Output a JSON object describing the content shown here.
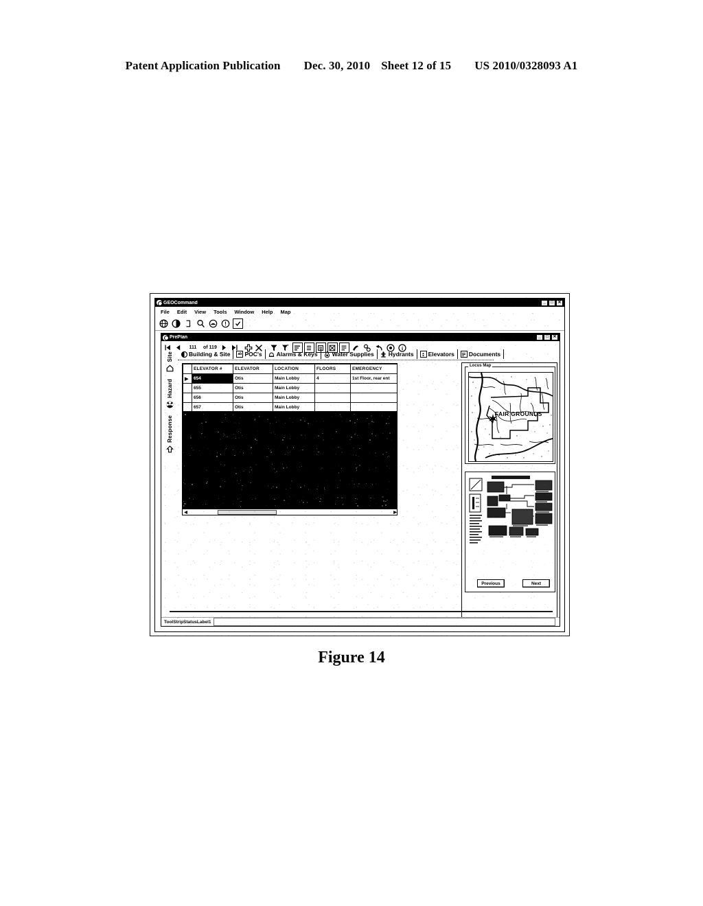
{
  "patent_header": {
    "publication": "Patent Application Publication",
    "date": "Dec. 30, 2010",
    "sheet": "Sheet 12 of 15",
    "number": "US 2010/0328093 A1"
  },
  "figure": {
    "caption": "Figure 14"
  },
  "app_window": {
    "title": "GEOCommand",
    "icon": "globe-icon",
    "window_buttons": [
      "_",
      "□",
      "✕"
    ],
    "menu": [
      "File",
      "Edit",
      "View",
      "Tools",
      "Window",
      "Help",
      "Map"
    ],
    "toolbar": [
      {
        "name": "globe-icon",
        "glyph": "ἱ0"
      },
      {
        "name": "locate-icon",
        "glyph": "◗"
      },
      {
        "name": "new-document-icon",
        "glyph": "⌐"
      },
      {
        "name": "search-icon",
        "glyph": "⌕"
      },
      {
        "name": "print-preview-icon",
        "glyph": "◑"
      },
      {
        "name": "alert-icon",
        "glyph": "☀"
      },
      {
        "name": "checklist-icon",
        "glyph": "✓"
      }
    ]
  },
  "preplan_window": {
    "title": "PrePlan",
    "icon": "preplan-icon",
    "window_buttons": [
      "_",
      "□",
      "✕"
    ],
    "navigation": {
      "first_label": "▏◀",
      "prev_label": "◀",
      "record_number": "111",
      "of_label": "of 119",
      "next_label": "▶",
      "last_label": "▶▕",
      "add_label": "✚",
      "delete_label": "✕"
    },
    "toolbar_icons": [
      {
        "name": "filter-icon",
        "glyph": "▽"
      },
      {
        "name": "filter-advanced-icon",
        "glyph": "▼"
      },
      {
        "name": "sort-icon",
        "glyph": "≣"
      },
      {
        "name": "copy-icon",
        "glyph": "⎘"
      },
      {
        "name": "paste-icon",
        "glyph": "ὌB"
      },
      {
        "name": "report-icon",
        "glyph": "☒"
      },
      {
        "name": "export-icon",
        "glyph": "☰"
      },
      {
        "name": "paint-icon",
        "glyph": "✎"
      },
      {
        "name": "find-icon",
        "glyph": "&"
      },
      {
        "name": "undo-icon",
        "glyph": "↰"
      },
      {
        "name": "help-icon",
        "glyph": "◉"
      },
      {
        "name": "info-icon",
        "glyph": "ⓘ"
      }
    ],
    "side_rail": [
      {
        "label": "Site",
        "icon": "house-icon",
        "glyph": "⌂"
      },
      {
        "label": "Hazard",
        "icon": "radiation-icon",
        "glyph": "☢"
      },
      {
        "label": "Response",
        "icon": "up-arrow-icon",
        "glyph": "⇧"
      }
    ],
    "tabs": [
      {
        "label": "Building & Site",
        "icon": "building-icon",
        "glyph": "◔",
        "active": false
      },
      {
        "label": "POC's",
        "icon": "contact-card-icon",
        "glyph": "ab",
        "active": false
      },
      {
        "label": "Alarms & Keys",
        "icon": "bell-icon",
        "glyph": "△",
        "active": false
      },
      {
        "label": "Water Supplies",
        "icon": "water-drop-icon",
        "glyph": "◆",
        "active": false
      },
      {
        "label": "Hydrants",
        "icon": "hydrant-icon",
        "glyph": "♖",
        "active": false
      },
      {
        "label": "Elevators",
        "icon": "elevator-icon",
        "glyph": "↕",
        "active": true
      },
      {
        "label": "Documents",
        "icon": "document-icon",
        "glyph": "☷",
        "active": false
      }
    ],
    "grid": {
      "columns": [
        "ELEVATOR #",
        "ELEVATOR",
        "LOCATION",
        "FLOORS",
        "EMERGENCY"
      ],
      "rows": [
        {
          "selector": "▶",
          "cells": [
            "654",
            "Otis",
            "Main Lobby",
            "4",
            "1st Floor, rear ent"
          ],
          "selected_cell": 0
        },
        {
          "selector": "",
          "cells": [
            "655",
            "Otis",
            "Main Lobby",
            "",
            ""
          ],
          "selected_cell": -1
        },
        {
          "selector": "",
          "cells": [
            "656",
            "Otis",
            "Main Lobby",
            "",
            ""
          ],
          "selected_cell": -1
        },
        {
          "selector": "",
          "cells": [
            "657",
            "Otis",
            "Main Lobby",
            "",
            ""
          ],
          "selected_cell": -1
        },
        {
          "selector": "✱",
          "cells": [
            "",
            "",
            "",
            "",
            ""
          ],
          "selected_cell": -1
        }
      ],
      "hscroll": {
        "left_arrow": "◀",
        "right_arrow": "▶"
      }
    },
    "right_panel": {
      "locus_map": {
        "legend": "Locus Map",
        "place_label": "FAIR GROUNDS",
        "marker": "star-marker"
      },
      "document_thumbnail": {
        "name": "site-plan-thumbnail"
      },
      "previous_label": "Previous",
      "next_label": "Next"
    },
    "status": {
      "label": "ToolStripStatusLabel1"
    }
  },
  "colors": {
    "ink": "#0b0b0b",
    "paper": "#ffffff",
    "titlebar": "#0b0b0b",
    "chrome": "#f2f2f2",
    "selected_cell": "#0a0a0a"
  }
}
